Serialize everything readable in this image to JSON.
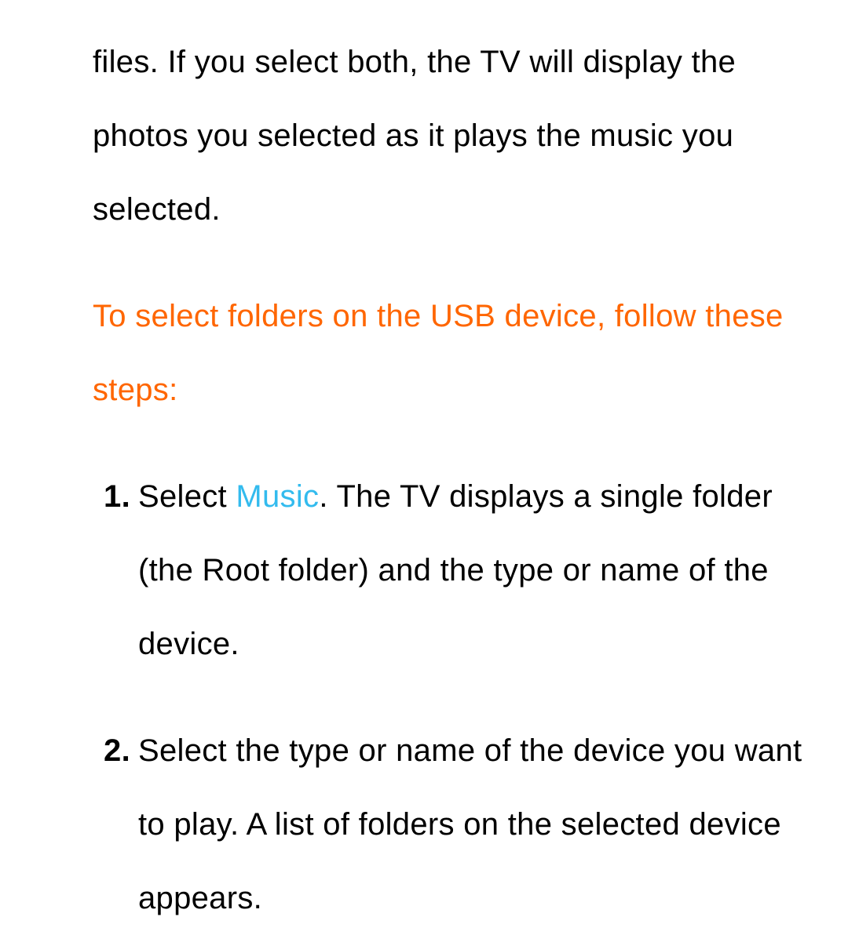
{
  "intro": "files. If you select both, the TV will display the photos you selected as it plays the music you selected.",
  "heading": "To select folders on the USB device, follow these steps:",
  "steps": [
    {
      "number": "1.",
      "prefix": "Select ",
      "highlight": "Music",
      "suffix": ". The TV displays a single folder (the Root folder) and the type or name of the device."
    },
    {
      "number": "2.",
      "prefix": "",
      "highlight": "",
      "suffix": "Select the type or name of the device you want to play. A list of folders on the selected device appears."
    }
  ]
}
